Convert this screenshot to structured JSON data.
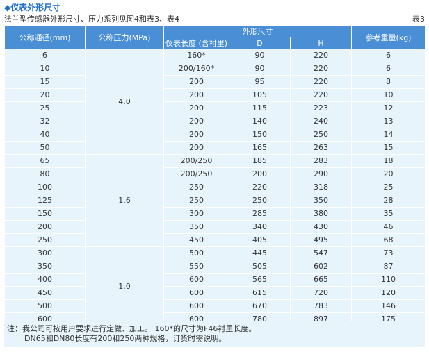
{
  "header": {
    "title": "◆仪表外形尺寸",
    "subtitle": "法兰型传感器外形尺寸、压力系列见图4和表3、表4",
    "table_tag": "表3"
  },
  "table": {
    "headers": {
      "dn": "公称通径(mm)",
      "pressure": "公称压力(MPa)",
      "dims": "外形尺寸",
      "length": "仪表长度 (含衬里)",
      "d": "D",
      "h": "H",
      "weight": "参考重量(kg)"
    },
    "pressure_groups": [
      "4.0",
      "1.6",
      "1.0"
    ],
    "rows": [
      [
        "6",
        "160*",
        "90",
        "220",
        "6"
      ],
      [
        "10",
        "200/160*",
        "90",
        "220",
        "6"
      ],
      [
        "15",
        "200",
        "95",
        "220",
        "8"
      ],
      [
        "20",
        "200",
        "105",
        "220",
        "10"
      ],
      [
        "25",
        "200",
        "115",
        "223",
        "12"
      ],
      [
        "32",
        "200",
        "140",
        "240",
        "13"
      ],
      [
        "40",
        "200",
        "150",
        "250",
        "14"
      ],
      [
        "50",
        "200",
        "165",
        "263",
        "15"
      ],
      [
        "65",
        "200/250",
        "185",
        "283",
        "18"
      ],
      [
        "80",
        "200/250",
        "200",
        "290",
        "20"
      ],
      [
        "100",
        "250",
        "220",
        "318",
        "25"
      ],
      [
        "125",
        "250",
        "250",
        "350",
        "28"
      ],
      [
        "150",
        "300",
        "285",
        "380",
        "35"
      ],
      [
        "200",
        "350",
        "340",
        "430",
        "46"
      ],
      [
        "250",
        "450",
        "405",
        "495",
        "68"
      ],
      [
        "300",
        "500",
        "445",
        "547",
        "73"
      ],
      [
        "350",
        "550",
        "505",
        "602",
        "87"
      ],
      [
        "400",
        "600",
        "565",
        "665",
        "110"
      ],
      [
        "450",
        "600",
        "615",
        "720",
        "120"
      ],
      [
        "500",
        "600",
        "670",
        "783",
        "146"
      ],
      [
        "600",
        "600",
        "780",
        "897",
        "175"
      ]
    ]
  },
  "note": {
    "line1": "注：我公司可按用户要求进行定做、加工。 160*的尺寸为F46衬里长度。",
    "line2": "DN65和DN80长度有200和250两种规格，订货时需说明。"
  },
  "colors": {
    "header_bg": "#4a8fd6",
    "cell_bg": "#e8f4fc",
    "title": "#1f6fc9"
  }
}
